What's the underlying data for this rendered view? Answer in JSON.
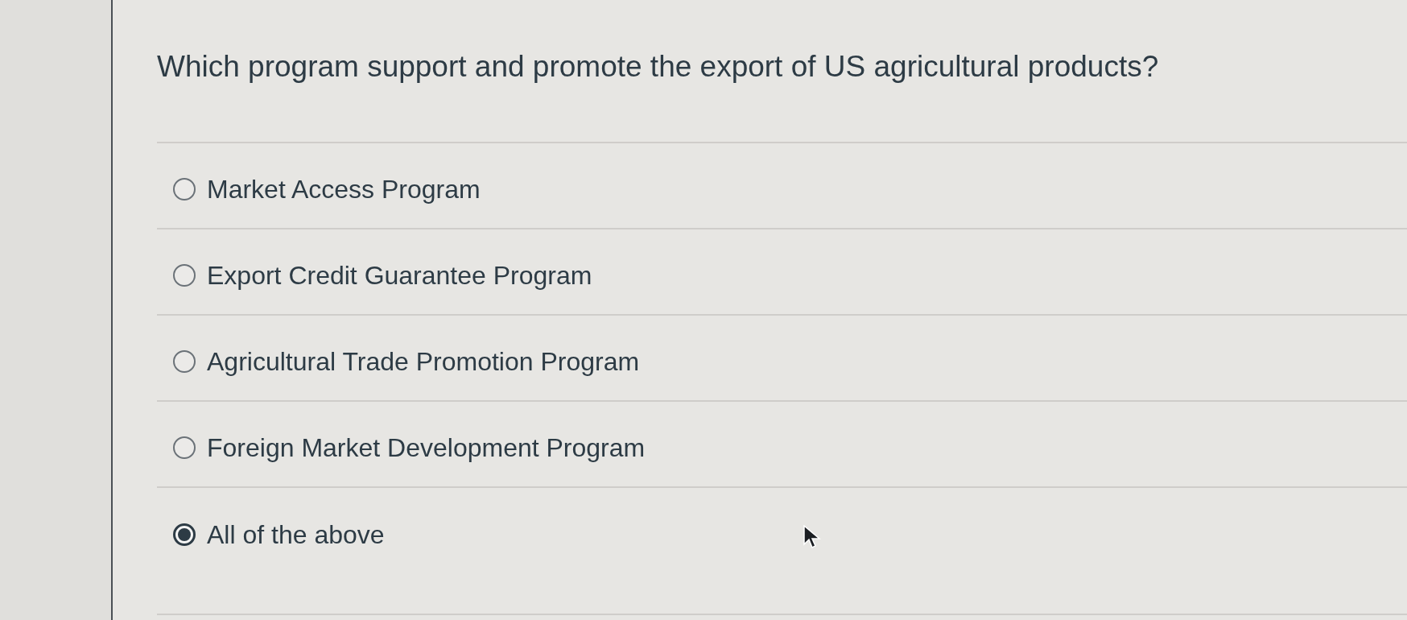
{
  "question": "Which program support and promote the export of US agricultural products?",
  "options": [
    {
      "label": "Market Access Program",
      "selected": false
    },
    {
      "label": "Export Credit Guarantee Program",
      "selected": false
    },
    {
      "label": "Agricultural Trade Promotion Program",
      "selected": false
    },
    {
      "label": "Foreign Market Development Program",
      "selected": false
    },
    {
      "label": "All of the above",
      "selected": true
    }
  ]
}
